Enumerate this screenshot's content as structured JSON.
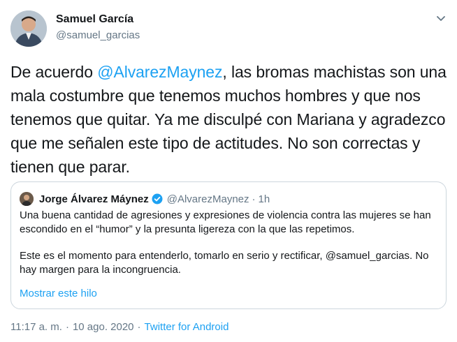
{
  "author": {
    "name": "Samuel García",
    "handle": "@samuel_garcias"
  },
  "tweet": {
    "text_before": "De acuerdo ",
    "mention": "@AlvarezMaynez",
    "text_after": ", las bromas machistas son una mala costumbre que tenemos muchos hombres y que nos tenemos que quitar. Ya me disculpé con Mariana y agradezco que me señalen este tipo de actitudes. No son correctas y tienen que parar."
  },
  "quote": {
    "name": "Jorge Álvarez Máynez",
    "handle": "@AlvarezMaynez",
    "dot": "·",
    "time": "1h",
    "paragraph1": "Una buena cantidad de agresiones y expresiones de violencia contra las mujeres se han escondido en el “humor” y la presunta ligereza con la que las repetimos.",
    "paragraph2": "Este es el momento para entenderlo, tomarlo en serio y rectificar, @samuel_garcias. No hay margen para la incongruencia.",
    "thread_link": "Mostrar este hilo"
  },
  "meta": {
    "time": "11:17 a. m.",
    "sep": "·",
    "date": "10 ago. 2020",
    "source": "Twitter for Android"
  },
  "colors": {
    "accent": "#1da1f2",
    "secondary_text": "#657786",
    "border": "#ccd6dd"
  }
}
